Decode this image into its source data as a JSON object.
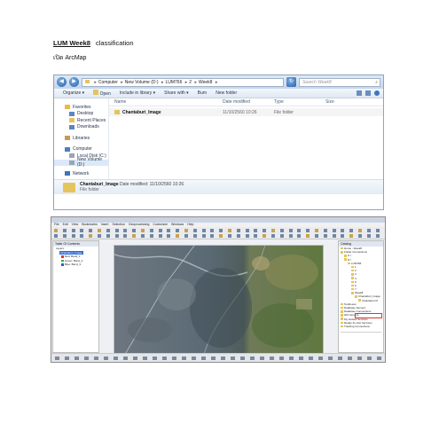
{
  "doc": {
    "title_underlined": "LUM Week8",
    "title_rest": "classification",
    "subtitle": "เปิด ArcMap"
  },
  "explorer": {
    "address": [
      "Computer",
      "New Volume (D:)",
      "LUM766",
      "2",
      "Week8"
    ],
    "search_placeholder": "Search Week8",
    "toolbar": [
      "Organize ▾",
      "Open",
      "Include in library ▾",
      "Share with ▾",
      "Burn",
      "New folder"
    ],
    "nav": {
      "favorites": {
        "label": "Favorites",
        "items": [
          "Desktop",
          "Recent Places",
          "Downloads"
        ]
      },
      "libraries": "Libraries",
      "computer": {
        "label": "Computer",
        "items": [
          "Local Disk (C:)",
          "New Volume (D:)"
        ]
      },
      "network": "Network"
    },
    "columns": [
      "Name",
      "Date modified",
      "Type",
      "Size"
    ],
    "files": [
      {
        "name": "Chantaburi_Image",
        "date": "11/10/2560 10:26",
        "type": "File folder",
        "size": ""
      }
    ],
    "details": {
      "name": "Chantaburi_Image",
      "meta": "Date modified: 11/10/2560 10:26",
      "type": "File folder"
    }
  },
  "arcmap": {
    "menu": [
      "File",
      "Edit",
      "View",
      "Bookmarks",
      "Insert",
      "Selection",
      "Geoprocessing",
      "Customize",
      "Windows",
      "Help"
    ],
    "toc": {
      "title": "Table Of Contents",
      "rows": [
        "Layers",
        "Chantaburi_Image",
        "Red: Band_1",
        "Green: Band_2",
        "Blue: Band_3"
      ]
    },
    "catalog": {
      "title": "Catalog",
      "rows": [
        "Home - Week8",
        "Folder Connections",
        "C:\\",
        "D:\\",
        "LUM766",
        "1",
        "2",
        "3",
        "4",
        "5",
        "6",
        "7",
        "Week8",
        "Chantaburi_Image",
        "Chantaburi.tif",
        "Toolboxes",
        "Database Servers",
        "Database Connections",
        "GIS Servers",
        "My Hosted Services",
        "Ready-To-Use Services",
        "Tracking Connections"
      ]
    },
    "colors": {
      "band_red": "#e0332b",
      "band_green": "#3aa83a",
      "band_blue": "#2d5bd8",
      "highlight": "#d23c2c"
    }
  }
}
